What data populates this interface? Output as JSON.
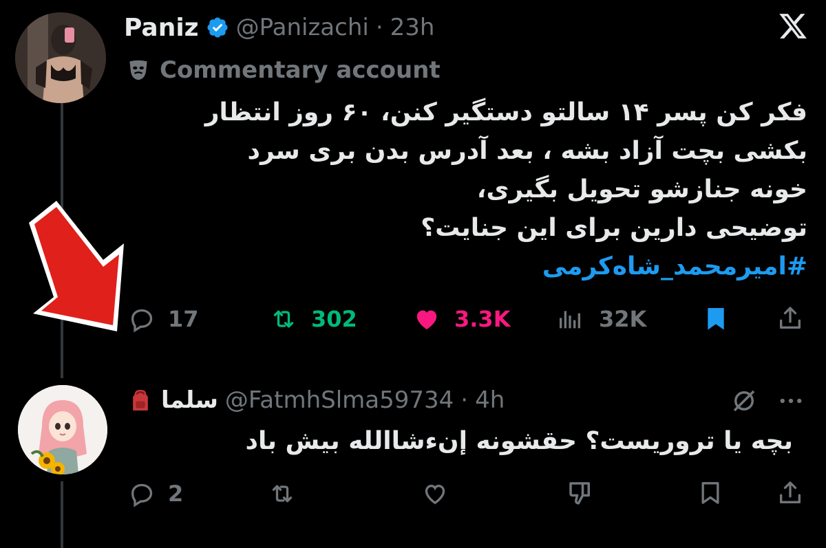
{
  "tweet": {
    "display_name": "Paniz",
    "handle": "@Panizachi",
    "separator": "·",
    "time": "23h",
    "label": "Commentary account",
    "lines": [
      "فکر کن پسر ۱۴ سالتو دستگیر کنن، ۶۰ روز انتظار",
      "بکشی بچت آزاد بشه ، بعد آدرس بدن بری سرد",
      "خونه جنازشو تحویل بگیری،",
      "توضیحی دارین برای این جنایت؟"
    ],
    "hashtag": "#امیرمحمد_شاه‌کرمی",
    "replies": "17",
    "reposts": "302",
    "likes": "3.3K",
    "views": "32K"
  },
  "reply": {
    "display_name": "سلما",
    "handle": "@FatmhSlma59734",
    "separator": "·",
    "time": "4h",
    "text": "بچه یا تروریست؟ حقشونه إن‌ءشاالله بیش باد",
    "replies": "2"
  },
  "colors": {
    "background": "#000000",
    "text": "#e7e9ea",
    "muted": "#71767b",
    "verified": "#1d9bf0",
    "hashtag": "#1d9bf0",
    "repost": "#00ba7c",
    "like": "#f91880",
    "arrow": "#e0201b"
  },
  "icons": [
    "x-logo-icon",
    "verified-badge-icon",
    "theater-mask-icon",
    "reply-icon",
    "repost-icon",
    "heart-icon",
    "views-icon",
    "bookmark-icon",
    "share-icon",
    "backpack-icon",
    "grok-icon",
    "more-icon",
    "downvote-icon"
  ]
}
